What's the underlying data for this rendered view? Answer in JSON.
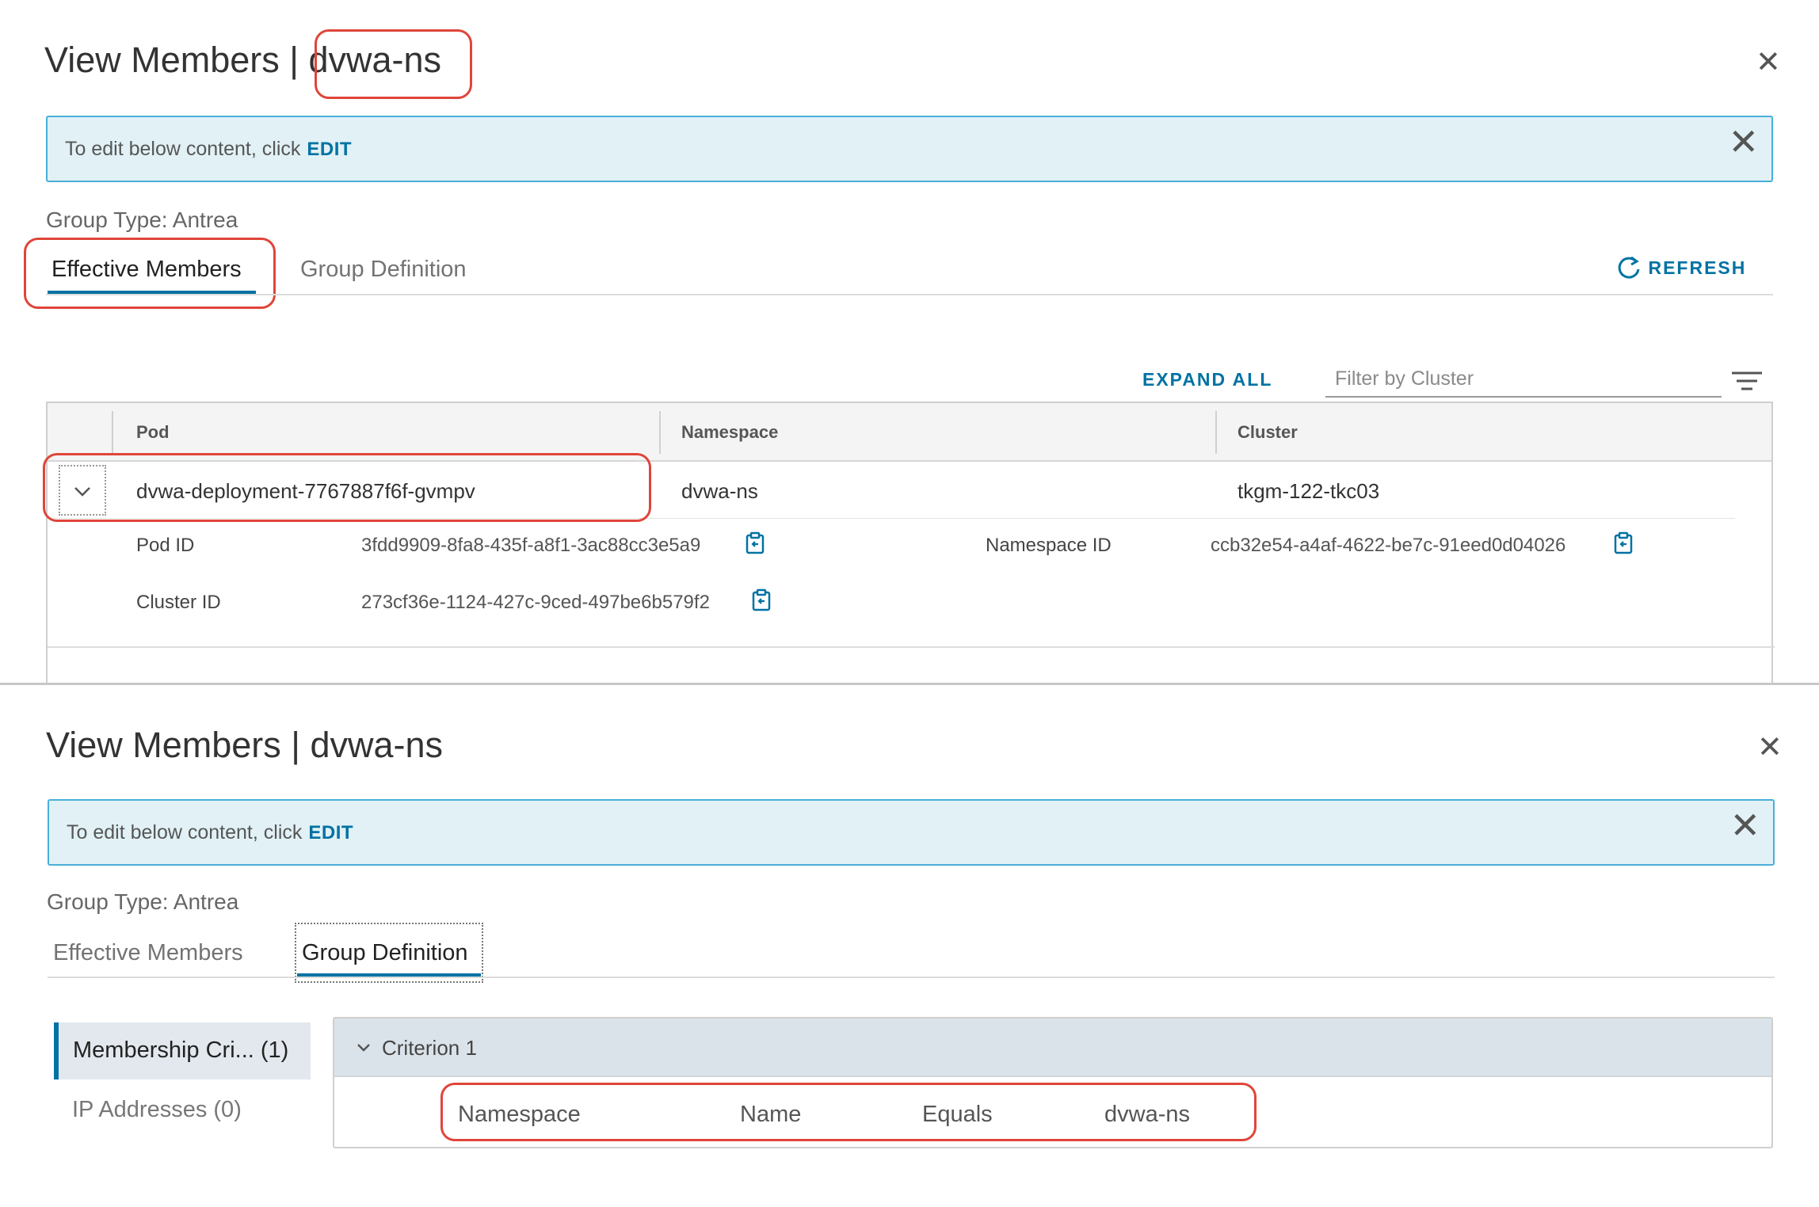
{
  "top": {
    "title_prefix": "View Members |",
    "title_group": "dvwa-ns",
    "banner": {
      "text": "To edit below content, click",
      "link": "EDIT"
    },
    "group_type": "Group Type: Antrea",
    "tabs": [
      {
        "label": "Effective Members",
        "active": true
      },
      {
        "label": "Group Definition",
        "active": false
      }
    ],
    "refresh_label": "REFRESH",
    "expand_all_label": "EXPAND ALL",
    "filter_placeholder": "Filter by Cluster",
    "columns": [
      "Pod",
      "Namespace",
      "Cluster"
    ],
    "row": {
      "pod": "dvwa-deployment-7767887f6f-gvmpv",
      "namespace": "dvwa-ns",
      "cluster": "tkgm-122-tkc03"
    },
    "details": {
      "pod_id_label": "Pod ID",
      "pod_id": "3fdd9909-8fa8-435f-a8f1-3ac88cc3e5a9",
      "namespace_id_label": "Namespace ID",
      "namespace_id": "ccb32e54-a4af-4622-be7c-91eed0d04026",
      "cluster_id_label": "Cluster ID",
      "cluster_id": "273cf36e-1124-427c-9ced-497be6b579f2"
    }
  },
  "bottom": {
    "title": "View Members | dvwa-ns",
    "banner": {
      "text": "To edit below content, click",
      "link": "EDIT"
    },
    "group_type": "Group Type: Antrea",
    "tabs": [
      {
        "label": "Effective Members",
        "active": false
      },
      {
        "label": "Group Definition",
        "active": true
      }
    ],
    "sidebar": [
      {
        "label": "Membership Cri... (1)",
        "active": true
      },
      {
        "label": "IP Addresses (0)",
        "active": false
      }
    ],
    "criterion": {
      "title": "Criterion 1",
      "member_type": "Namespace",
      "key": "Name",
      "operator": "Equals",
      "value": "dvwa-ns"
    }
  },
  "colors": {
    "accent": "#0072a3",
    "banner_bg": "#e1f1f6",
    "banner_border": "#49afd9",
    "annotation": "#e0453a"
  }
}
